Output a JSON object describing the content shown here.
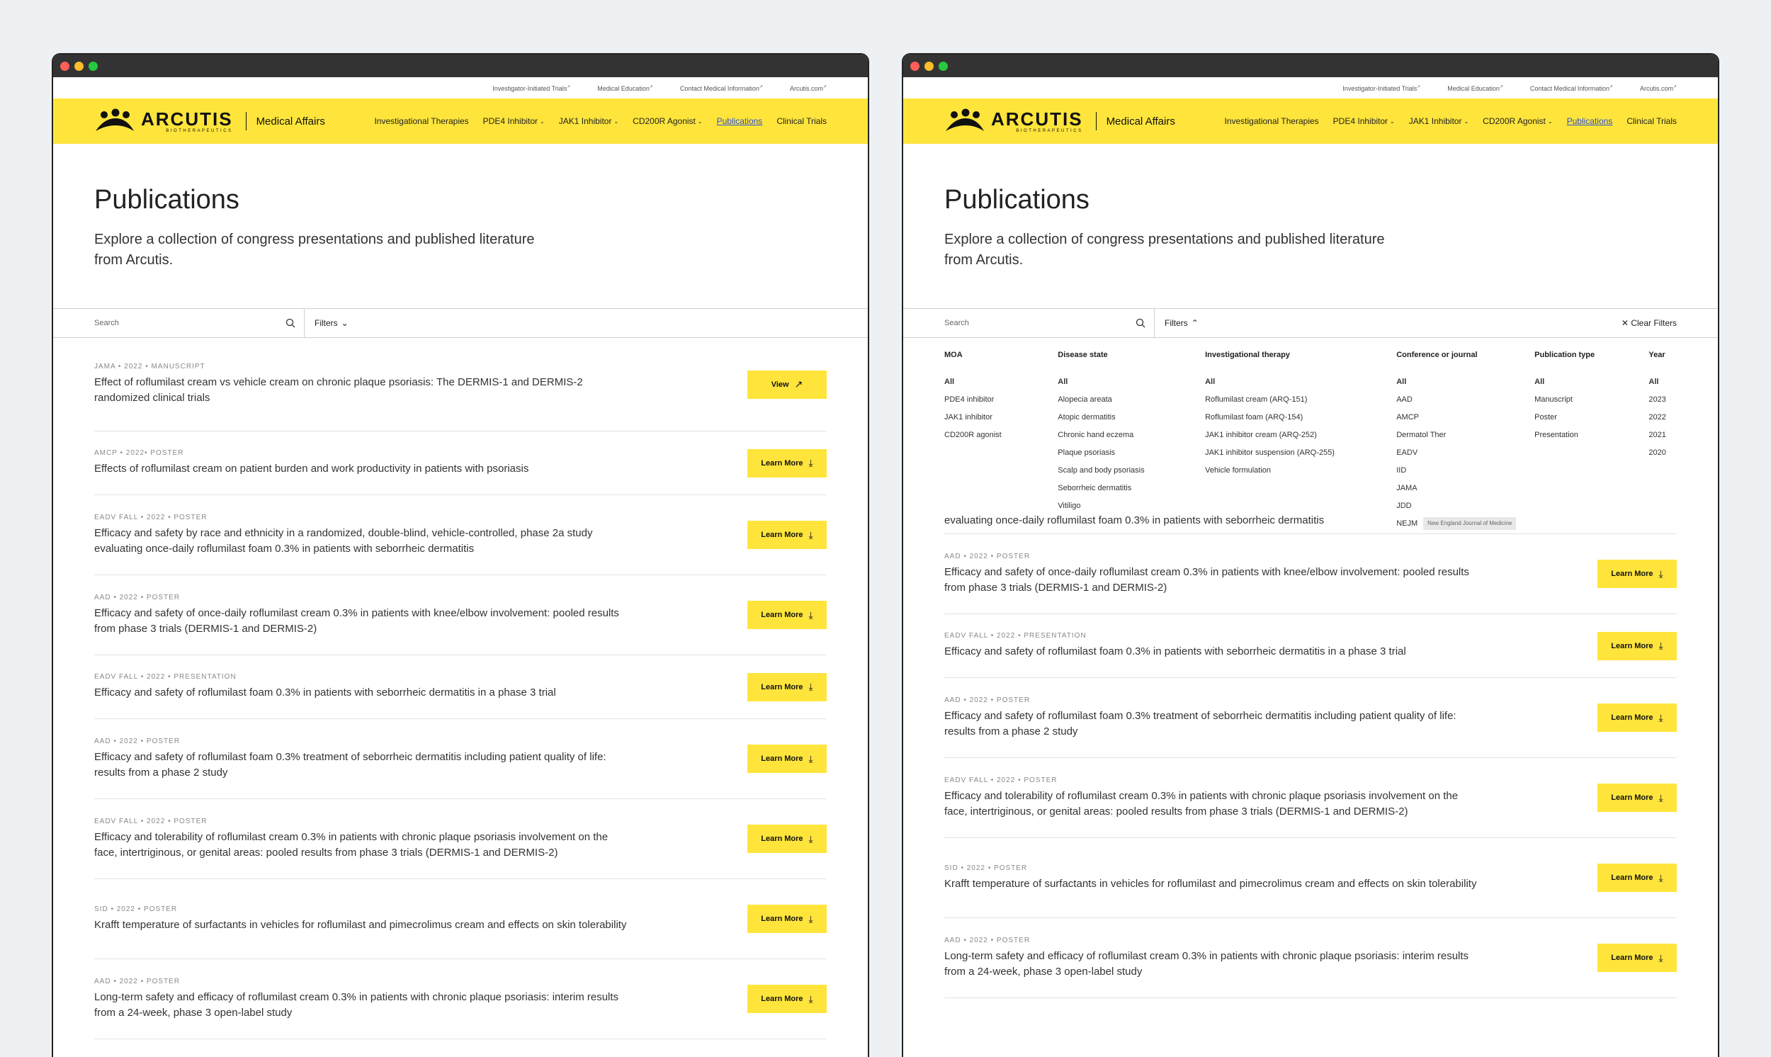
{
  "utility_links": [
    "Investigator-Initiated Trials",
    "Medical Education",
    "Contact Medical Information",
    "Arcutis.com"
  ],
  "brand": {
    "logo_word": "ARCUTIS",
    "logo_sub": "BIOTHERAPEUTICS",
    "section": "Medical Affairs"
  },
  "nav": [
    {
      "label": "Investigational Therapies",
      "dropdown": false,
      "active": false
    },
    {
      "label": "PDE4 Inhibitor",
      "dropdown": true,
      "active": false
    },
    {
      "label": "JAK1 Inhibitor",
      "dropdown": true,
      "active": false
    },
    {
      "label": "CD200R Agonist",
      "dropdown": true,
      "active": false
    },
    {
      "label": "Publications",
      "dropdown": false,
      "active": true
    },
    {
      "label": "Clinical Trials",
      "dropdown": false,
      "active": false
    }
  ],
  "hero": {
    "title": "Publications",
    "description": "Explore a collection of congress presentations and published literature from Arcutis."
  },
  "search": {
    "placeholder": "Search"
  },
  "filters": {
    "label": "Filters",
    "clear_label": "Clear Filters"
  },
  "filter_panel": [
    {
      "heading": "MOA",
      "options": [
        "All",
        "PDE4 inhibitor",
        "JAK1 inhibitor",
        "CD200R agonist"
      ]
    },
    {
      "heading": "Disease state",
      "options": [
        "All",
        "Alopecia areata",
        "Atopic dermatitis",
        "Chronic hand eczema",
        "Plaque psoriasis",
        "Scalp and body psoriasis",
        "Seborrheic dermatitis",
        "Vitiligo"
      ]
    },
    {
      "heading": "Investigational therapy",
      "options": [
        "All",
        "Roflumilast cream (ARQ-151)",
        "Roflumilast foam (ARQ-154)",
        "JAK1 inhibitor cream (ARQ-252)",
        "JAK1 inhibitor suspension (ARQ-255)",
        "Vehicle formulation"
      ]
    },
    {
      "heading": "Conference or journal",
      "options": [
        "All",
        "AAD",
        "AMCP",
        "Dermatol Ther",
        "EADV",
        "IID",
        "JAMA",
        "JDD",
        "NEJM"
      ]
    },
    {
      "heading": "Publication type",
      "options": [
        "All",
        "Manuscript",
        "Poster",
        "Presentation"
      ]
    },
    {
      "heading": "Year",
      "options": [
        "All",
        "2023",
        "2022",
        "2021",
        "2020"
      ]
    }
  ],
  "tooltip": "New England Journal of Medicine",
  "cut_title": "evaluating once-daily roflumilast foam 0.3% in patients with seborrheic dermatitis",
  "publications": [
    {
      "meta": "JAMA • 2022 • MANUSCRIPT",
      "title": "Effect of roflumilast cream vs vehicle cream on chronic plaque psoriasis: The DERMIS-1 and DERMIS-2 randomized clinical trials",
      "button": "View",
      "icon": "↗"
    },
    {
      "meta": "AMCP • 2022• POSTER",
      "title": "Effects of roflumilast cream on patient burden and work productivity in patients with psoriasis",
      "button": "Learn More",
      "icon": "⤓"
    },
    {
      "meta": "EADV FALL • 2022 • POSTER",
      "title": "Efficacy and safety by race and ethnicity in a randomized, double-blind, vehicle-controlled, phase 2a study evaluating once-daily roflumilast foam 0.3% in patients with seborrheic dermatitis",
      "button": "Learn More",
      "icon": "⤓"
    },
    {
      "meta": "AAD • 2022 • POSTER",
      "title": "Efficacy and safety of once-daily roflumilast cream 0.3% in patients with knee/elbow involvement: pooled results from phase 3 trials (DERMIS-1 and DERMIS-2)",
      "button": "Learn More",
      "icon": "⤓"
    },
    {
      "meta": "EADV FALL • 2022 • PRESENTATION",
      "title": "Efficacy and safety of roflumilast foam 0.3% in patients with seborrheic dermatitis in a phase 3 trial",
      "button": "Learn More",
      "icon": "⤓"
    },
    {
      "meta": "AAD • 2022 • POSTER",
      "title": "Efficacy and safety of roflumilast foam 0.3% treatment of seborrheic dermatitis including patient quality of life: results from a phase 2 study",
      "button": "Learn More",
      "icon": "⤓"
    },
    {
      "meta": "EADV FALL • 2022 • POSTER",
      "title": "Efficacy and tolerability of roflumilast cream 0.3% in patients with chronic plaque psoriasis involvement on the face, intertriginous, or genital areas: pooled results from phase 3 trials (DERMIS-1 and DERMIS-2)",
      "button": "Learn More",
      "icon": "⤓"
    },
    {
      "meta": "SID • 2022 • POSTER",
      "title": "Krafft temperature of surfactants in vehicles for roflumilast and pimecrolimus cream and effects on skin tolerability",
      "button": "Learn More",
      "icon": "⤓"
    },
    {
      "meta": "AAD • 2022 • POSTER",
      "title": "Long-term safety and efficacy of roflumilast cream 0.3% in patients with chronic plaque psoriasis: interim results from a 24-week, phase 3 open-label study",
      "button": "Learn More",
      "icon": "⤓"
    }
  ],
  "colors": {
    "accent_yellow": "#ffe53b",
    "active_link": "#2a4fd6",
    "chrome": "#333333"
  }
}
